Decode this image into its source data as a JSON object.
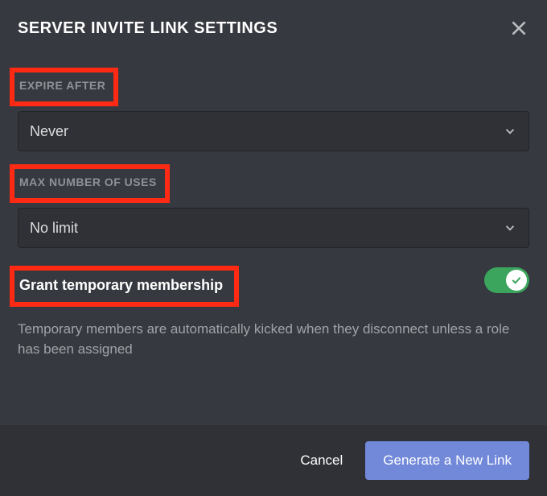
{
  "header": {
    "title": "SERVER INVITE LINK SETTINGS"
  },
  "expire": {
    "label": "EXPIRE AFTER",
    "value": "Never"
  },
  "maxUses": {
    "label": "MAX NUMBER OF USES",
    "value": "No limit"
  },
  "tempMembership": {
    "label": "Grant temporary membership",
    "helper": "Temporary members are automatically kicked when they disconnect unless a role has been assigned",
    "enabled": true
  },
  "footer": {
    "cancel": "Cancel",
    "generate": "Generate a New Link"
  },
  "colors": {
    "accent": "#7289da",
    "toggleOn": "#3ba55d",
    "highlight": "#ff2a14"
  }
}
